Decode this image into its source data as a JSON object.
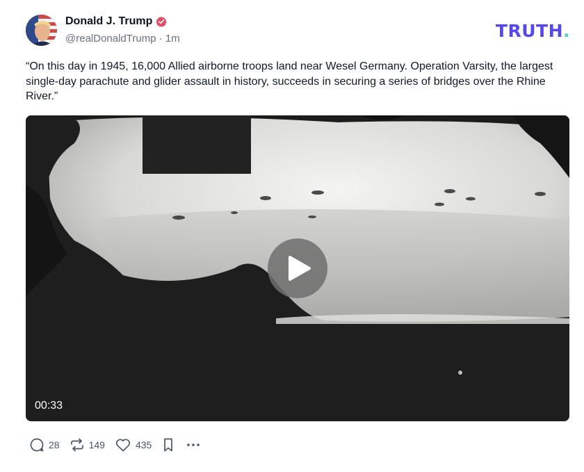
{
  "post": {
    "author_name": "Donald J. Trump",
    "handle": "@realDonaldTrump",
    "separator": "·",
    "time": "1m",
    "brand_logo": "TRUTH",
    "brand_logo_dot": ".",
    "text": "“On this day in 1945, 16,000 Allied airborne troops land near Wesel Germany. Operation Varsity, the largest single-day parachute and glider assault in history, succeeds in securing a series of bridges over the Rhine River.”",
    "video": {
      "duration": "00:33"
    },
    "actions": {
      "replies_icon": "comment-icon",
      "replies": "28",
      "retruths_icon": "retruth-icon",
      "retruths": "149",
      "likes_icon": "heart-icon",
      "likes": "435",
      "bookmark_icon": "bookmark-icon",
      "more_icon": "more-icon"
    }
  },
  "colors": {
    "brand": "#5448ee",
    "brand_dot": "#4fd1c5",
    "verified": "#e04e68",
    "muted": "#6b7280"
  }
}
